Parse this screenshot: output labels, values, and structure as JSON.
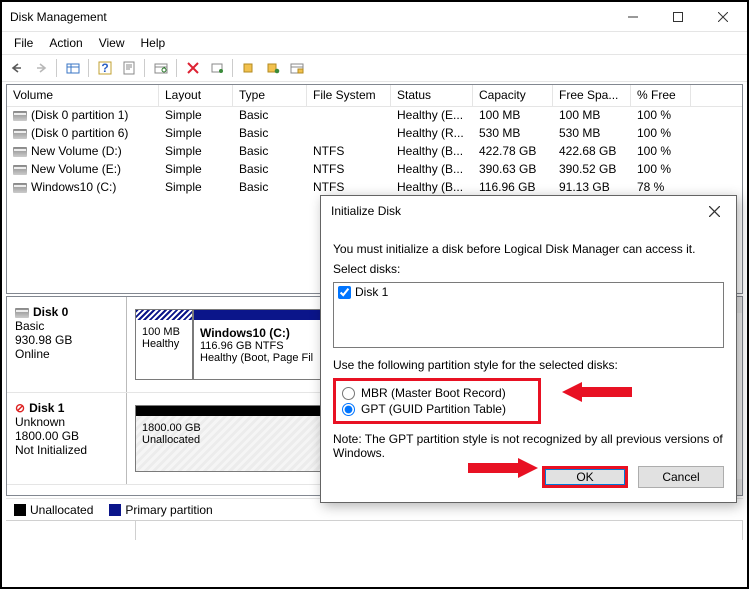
{
  "window": {
    "title": "Disk Management"
  },
  "menu": [
    "File",
    "Action",
    "View",
    "Help"
  ],
  "columns": [
    "Volume",
    "Layout",
    "Type",
    "File System",
    "Status",
    "Capacity",
    "Free Spa...",
    "% Free"
  ],
  "volumes": [
    {
      "name": "(Disk 0 partition 1)",
      "layout": "Simple",
      "type": "Basic",
      "fs": "",
      "status": "Healthy (E...",
      "cap": "100 MB",
      "free": "100 MB",
      "pct": "100 %"
    },
    {
      "name": "(Disk 0 partition 6)",
      "layout": "Simple",
      "type": "Basic",
      "fs": "",
      "status": "Healthy (R...",
      "cap": "530 MB",
      "free": "530 MB",
      "pct": "100 %"
    },
    {
      "name": "New Volume (D:)",
      "layout": "Simple",
      "type": "Basic",
      "fs": "NTFS",
      "status": "Healthy (B...",
      "cap": "422.78 GB",
      "free": "422.68 GB",
      "pct": "100 %"
    },
    {
      "name": "New Volume (E:)",
      "layout": "Simple",
      "type": "Basic",
      "fs": "NTFS",
      "status": "Healthy (B...",
      "cap": "390.63 GB",
      "free": "390.52 GB",
      "pct": "100 %"
    },
    {
      "name": "Windows10 (C:)",
      "layout": "Simple",
      "type": "Basic",
      "fs": "NTFS",
      "status": "Healthy (B...",
      "cap": "116.96 GB",
      "free": "91.13 GB",
      "pct": "78 %"
    }
  ],
  "disk0": {
    "name": "Disk 0",
    "kind": "Basic",
    "size": "930.98 GB",
    "state": "Online",
    "part1": {
      "size": "100 MB",
      "status": "Healthy"
    },
    "part2": {
      "title": "Windows10  (C:)",
      "line1": "116.96 GB NTFS",
      "line2": "Healthy (Boot, Page Fil"
    }
  },
  "disk1": {
    "name": "Disk 1",
    "kind": "Unknown",
    "size": "1800.00 GB",
    "state": "Not Initialized",
    "part": {
      "size": "1800.00 GB",
      "status": "Unallocated"
    }
  },
  "legend": {
    "unalloc": "Unallocated",
    "primary": "Primary partition"
  },
  "dialog": {
    "title": "Initialize Disk",
    "intro": "You must initialize a disk before Logical Disk Manager can access it.",
    "select_label": "Select disks:",
    "disk_item": "Disk 1",
    "style_label": "Use the following partition style for the selected disks:",
    "mbr": "MBR (Master Boot Record)",
    "gpt": "GPT (GUID Partition Table)",
    "note": "Note: The GPT partition style is not recognized by all previous versions of Windows.",
    "ok": "OK",
    "cancel": "Cancel"
  }
}
